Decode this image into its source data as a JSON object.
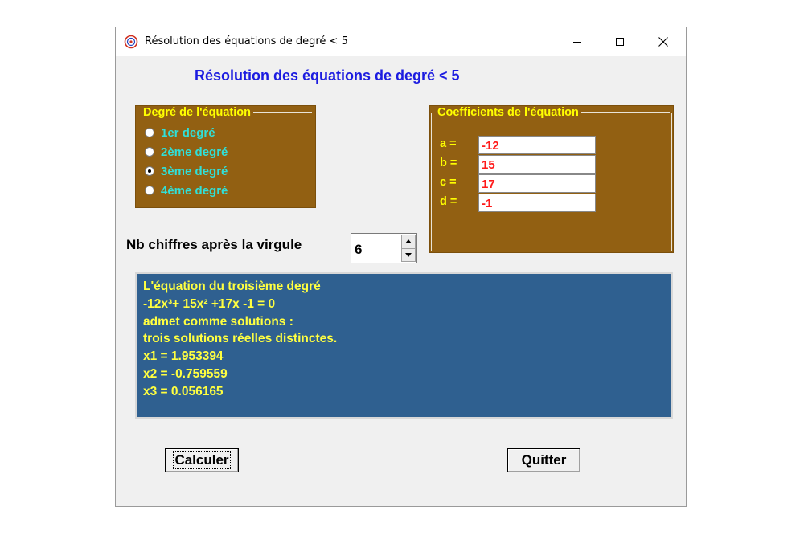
{
  "window": {
    "title": "Résolution des équations de degré < 5"
  },
  "heading": "Résolution des équations de degré < 5",
  "degree_group": {
    "legend": "Degré de l'équation",
    "options": [
      {
        "label": "1er degré",
        "checked": false
      },
      {
        "label": "2ème degré",
        "checked": false
      },
      {
        "label": "3ème degré",
        "checked": true
      },
      {
        "label": "4ème degré",
        "checked": false
      }
    ]
  },
  "coef_group": {
    "legend": "Coefficients de l'équation",
    "fields": [
      {
        "label": "a =",
        "value": "-12"
      },
      {
        "label": "b =",
        "value": "15"
      },
      {
        "label": "c =",
        "value": "17"
      },
      {
        "label": "d =",
        "value": "-1"
      }
    ]
  },
  "digits": {
    "label": "Nb chiffres après la virgule",
    "value": "6"
  },
  "result": {
    "lines": [
      "L'équation du troisième degré",
      "-12x³+ 15x² +17x -1 = 0",
      "admet comme solutions :",
      "trois solutions réelles distinctes.",
      "x1 = 1.953394",
      "x2 = -0.759559",
      "x3 = 0.056165"
    ]
  },
  "buttons": {
    "calculate": "Calculer",
    "quit": "Quitter"
  },
  "colors": {
    "group_bg": "#926012",
    "heading": "#1c1ce0",
    "legend_text": "#ffff00",
    "radio_text": "#30e0d8",
    "coef_text": "#ff1a1a",
    "result_bg": "#2f6090",
    "result_text": "#ffff40"
  }
}
